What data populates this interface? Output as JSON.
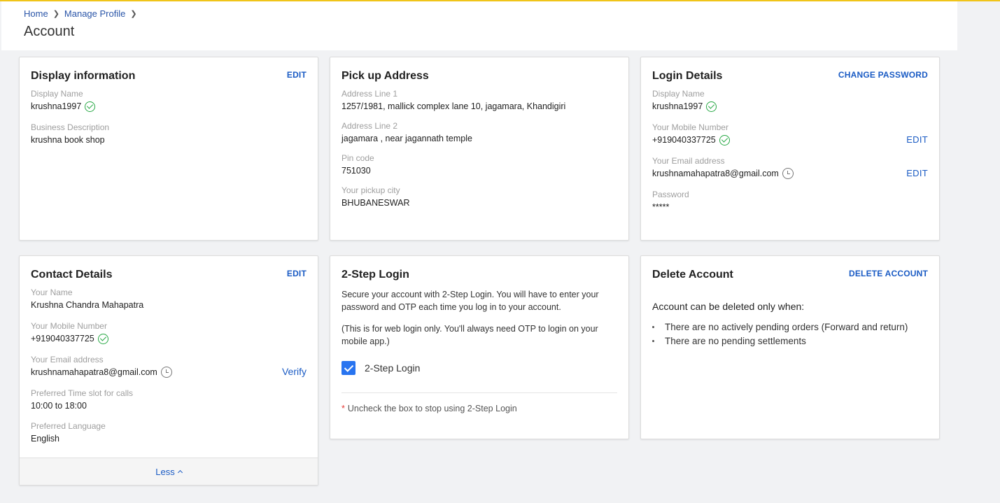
{
  "breadcrumb": {
    "home": "Home",
    "manage_profile": "Manage Profile"
  },
  "page_title": "Account",
  "display_info": {
    "title": "Display information",
    "action": "EDIT",
    "display_name_label": "Display Name",
    "display_name_value": "krushna1997",
    "business_desc_label": "Business Description",
    "business_desc_value": "krushna book shop"
  },
  "pickup": {
    "title": "Pick up Address",
    "line1_label": "Address Line 1",
    "line1_value": "1257/1981, mallick complex lane 10, jagamara, Khandigiri",
    "line2_label": "Address Line 2",
    "line2_value": "jagamara , near jagannath temple",
    "pincode_label": "Pin code",
    "pincode_value": "751030",
    "city_label": "Your pickup city",
    "city_value": "BHUBANESWAR"
  },
  "login_details": {
    "title": "Login Details",
    "action": "CHANGE PASSWORD",
    "display_name_label": "Display Name",
    "display_name_value": "krushna1997",
    "mobile_label": "Your Mobile Number",
    "mobile_value": "+919040337725",
    "mobile_edit": "EDIT",
    "email_label": "Your Email address",
    "email_value": "krushnamahapatra8@gmail.com",
    "email_edit": "EDIT",
    "password_label": "Password",
    "password_value": "*****"
  },
  "contact": {
    "title": "Contact Details",
    "action": "EDIT",
    "name_label": "Your Name",
    "name_value": "Krushna Chandra Mahapatra",
    "mobile_label": "Your Mobile Number",
    "mobile_value": "+919040337725",
    "email_label": "Your Email address",
    "email_value": "krushnamahapatra8@gmail.com",
    "verify": "Verify",
    "timeslot_label": "Preferred Time slot for calls",
    "timeslot_value": "10:00 to 18:00",
    "language_label": "Preferred Language",
    "language_value": "English",
    "less": "Less"
  },
  "two_step": {
    "title": "2-Step Login",
    "desc1": "Secure your account with 2-Step Login. You will have to enter your password and OTP each time you log in to your account.",
    "desc2": "(This is for web login only. You'll always need OTP to login on your mobile app.)",
    "checkbox_label": "2-Step Login",
    "checked": true,
    "note_star": "*",
    "note": "Uncheck the box to stop using 2-Step Login"
  },
  "delete_account": {
    "title": "Delete Account",
    "action": "DELETE ACCOUNT",
    "subtitle": "Account can be deleted only when:",
    "conditions": [
      "There are no actively pending orders (Forward and return)",
      "There are no pending settlements"
    ]
  },
  "icons": {
    "verified": "check-circle-icon",
    "pending": "clock-icon",
    "breadcrumb_sep": "chevron-right-icon",
    "less": "chevron-up-icon"
  },
  "colors": {
    "accent": "#1a5bc4",
    "verified": "#27a844",
    "checkbox": "#2874f0",
    "top_line": "#f0c419"
  }
}
